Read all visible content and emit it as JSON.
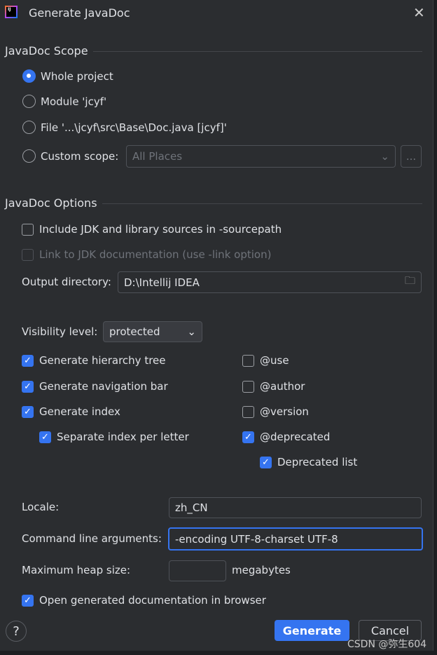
{
  "window": {
    "title": "Generate JavaDoc",
    "logo_text": "IJ"
  },
  "scope": {
    "heading": "JavaDoc Scope",
    "options": [
      "Whole project",
      "Module 'jcyf'",
      "File '...\\jcyf\\src\\Base\\Doc.java [jcyf]'",
      "Custom scope:"
    ],
    "selected": 0,
    "custom_scope_value": "All Places",
    "browse_label": "..."
  },
  "options": {
    "heading": "JavaDoc Options",
    "include_jdk": {
      "label": "Include JDK and library sources in -sourcepath",
      "checked": false
    },
    "link_jdk": {
      "label": "Link to JDK documentation (use -link option)",
      "checked": false,
      "disabled": true
    },
    "output_label": "Output directory:",
    "output_value": "D:\\Intellij IDEA",
    "visibility_label": "Visibility level:",
    "visibility_value": "protected"
  },
  "checks_left": [
    {
      "label": "Generate hierarchy tree",
      "checked": true
    },
    {
      "label": "Generate navigation bar",
      "checked": true
    },
    {
      "label": "Generate index",
      "checked": true
    },
    {
      "label": "Separate index per letter",
      "checked": true
    }
  ],
  "checks_right": [
    {
      "label": "@use",
      "checked": false
    },
    {
      "label": "@author",
      "checked": false
    },
    {
      "label": "@version",
      "checked": false
    },
    {
      "label": "@deprecated",
      "checked": true
    },
    {
      "label": "Deprecated list",
      "checked": true
    }
  ],
  "locale": {
    "label": "Locale:",
    "value": "zh_CN"
  },
  "cmd": {
    "label": "Command line arguments:",
    "value": "-encoding UTF-8-charset UTF-8"
  },
  "heap": {
    "label": "Maximum heap size:",
    "value": "",
    "unit": "megabytes"
  },
  "open_browser": {
    "label": "Open generated documentation in browser",
    "checked": true
  },
  "footer": {
    "help": "?",
    "generate": "Generate",
    "cancel": "Cancel",
    "watermark": "CSDN @弥生604"
  },
  "colors": {
    "accent": "#3574f0",
    "background": "#2b2d30"
  }
}
